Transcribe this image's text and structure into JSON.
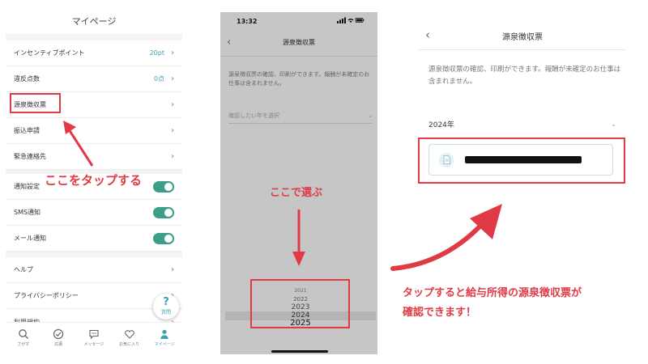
{
  "panel1": {
    "title": "マイページ",
    "menu": [
      {
        "label": "インセンティブポイント",
        "value": "20pt"
      },
      {
        "label": "違反点数",
        "value": "0点"
      },
      {
        "label": "源泉徴収票",
        "value": ""
      },
      {
        "label": "振込申請",
        "value": ""
      },
      {
        "label": "緊急連絡先",
        "value": ""
      }
    ],
    "settings": [
      {
        "label": "通知設定",
        "on": true
      },
      {
        "label": "SMS通知",
        "on": true
      },
      {
        "label": "メール通知",
        "on": true
      }
    ],
    "links": [
      "ヘルプ",
      "プライバシーポリシー",
      "利用規約"
    ],
    "help_bubble": {
      "mark": "?",
      "label": "質問"
    },
    "tabs": [
      "さがす",
      "応募",
      "メッセージ",
      "お気に入り",
      "マイページ"
    ],
    "annotation": "ここをタップする"
  },
  "panel2": {
    "time": "13:32",
    "title": "源泉徴収票",
    "description": "源泉徴収票の確認、印刷ができます。報酬が未確定のお仕事は含まれません。",
    "select_placeholder": "確認したい年を選択",
    "annotation": "ここで選ぶ",
    "picker_years": [
      "2021",
      "2022",
      "2023",
      "2024",
      "2025"
    ]
  },
  "panel3": {
    "title": "源泉徴収票",
    "description": "源泉徴収票の確認、印刷ができます。報酬が未確定のお仕事は含まれません。",
    "year": "2024年"
  },
  "annotation_bottom": {
    "line1": "タップすると給与所得の源泉徴収票が",
    "line2": "確認できます！"
  },
  "colors": {
    "accent_red": "#e03a45",
    "accent_teal": "#3aa1b8",
    "toggle_green": "#3c9d8a"
  }
}
